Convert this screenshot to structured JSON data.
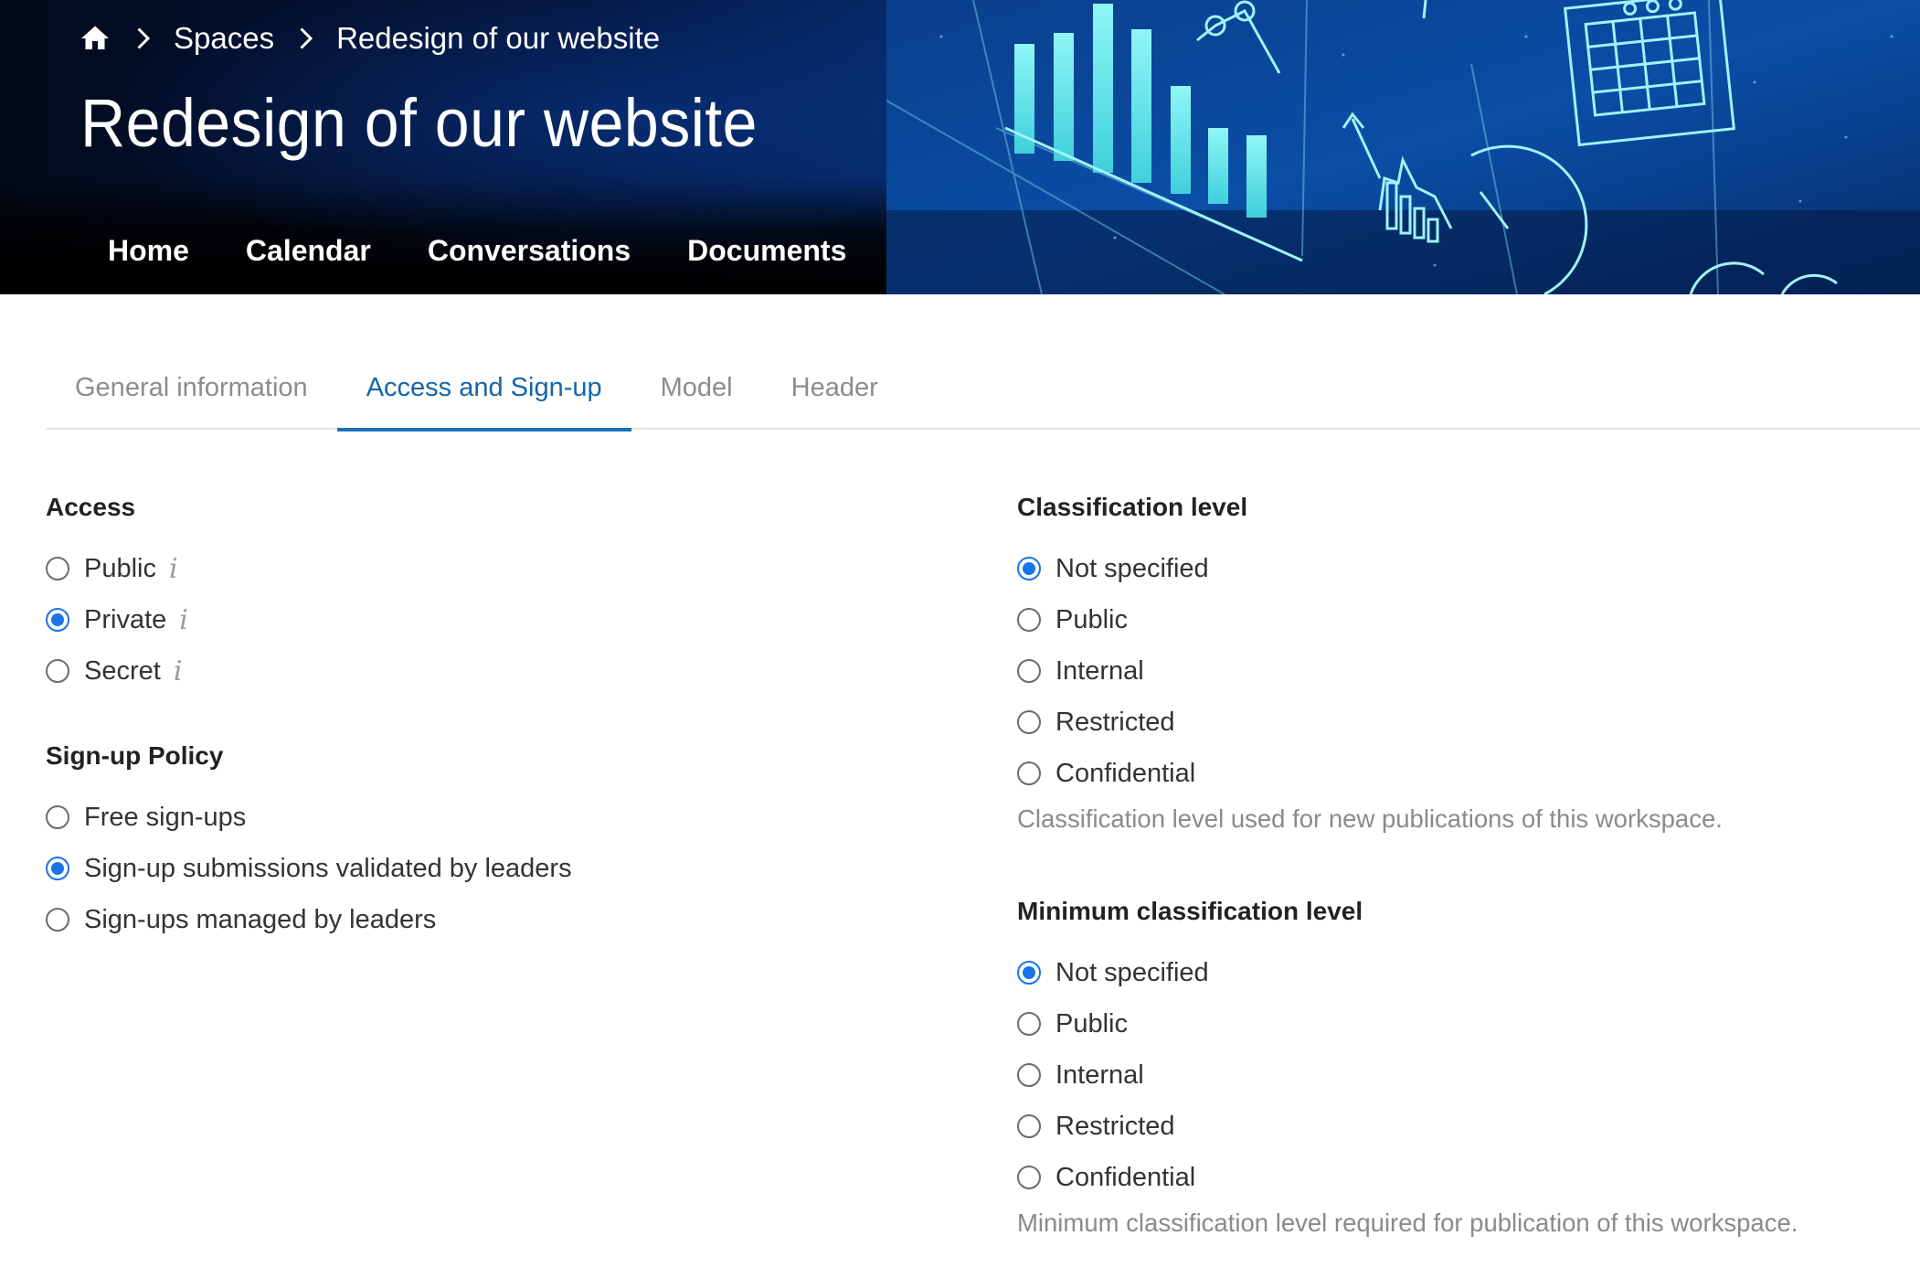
{
  "header": {
    "breadcrumb": {
      "home_icon": "home-icon",
      "items": [
        "Spaces",
        "Redesign of our website"
      ]
    },
    "title": "Redesign of our website",
    "nav": [
      "Home",
      "Calendar",
      "Conversations",
      "Documents"
    ]
  },
  "tabs": {
    "items": [
      "General information",
      "Access and Sign-up",
      "Model",
      "Header"
    ],
    "active": "Access and Sign-up"
  },
  "access": {
    "title": "Access",
    "options": [
      {
        "label": "Public",
        "checked": false,
        "info": "i"
      },
      {
        "label": "Private",
        "checked": true,
        "info": "i"
      },
      {
        "label": "Secret",
        "checked": false,
        "info": "i"
      }
    ]
  },
  "signup": {
    "title": "Sign-up Policy",
    "options": [
      {
        "label": "Free sign-ups",
        "checked": false
      },
      {
        "label": "Sign-up submissions validated by leaders",
        "checked": true
      },
      {
        "label": "Sign-ups managed by leaders",
        "checked": false
      }
    ]
  },
  "classification": {
    "title": "Classification level",
    "options": [
      {
        "label": "Not specified",
        "checked": true
      },
      {
        "label": "Public",
        "checked": false
      },
      {
        "label": "Internal",
        "checked": false
      },
      {
        "label": "Restricted",
        "checked": false
      },
      {
        "label": "Confidential",
        "checked": false
      }
    ],
    "help": "Classification level used for new publications of this workspace."
  },
  "min_classification": {
    "title": "Minimum classification level",
    "options": [
      {
        "label": "Not specified",
        "checked": true
      },
      {
        "label": "Public",
        "checked": false
      },
      {
        "label": "Internal",
        "checked": false
      },
      {
        "label": "Restricted",
        "checked": false
      },
      {
        "label": "Confidential",
        "checked": false
      }
    ],
    "help": "Minimum classification level required for publication of this workspace."
  },
  "colors": {
    "accent": "#1a73e8",
    "tab_active": "#1565a8",
    "banner_dark": "#020a1c",
    "art_cyan": "#7ff0f0"
  }
}
